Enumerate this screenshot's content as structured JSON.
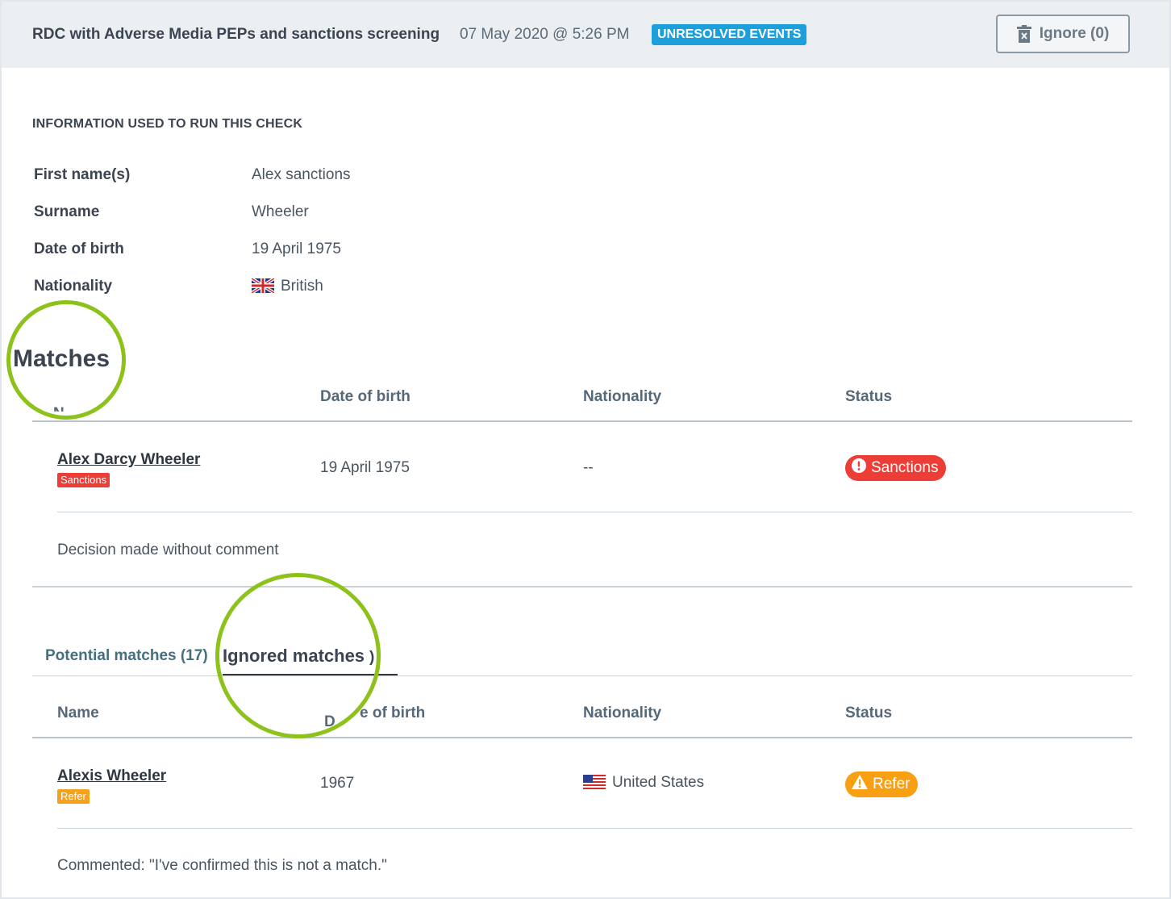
{
  "header": {
    "title": "RDC with Adverse Media PEPs and sanctions screening",
    "datetime": "07 May 2020 @ 5:26 PM",
    "badge": "UNRESOLVED EVENTS",
    "ignore_button": "Ignore (0)",
    "icon": "trash-icon"
  },
  "info": {
    "title": "INFORMATION USED TO RUN THIS CHECK",
    "fields": [
      {
        "label": "First name(s)",
        "value": "Alex sanctions"
      },
      {
        "label": "Surname",
        "value": "Wheeler"
      },
      {
        "label": "Date of birth",
        "value": "19 April 1975"
      },
      {
        "label": "Nationality",
        "value": "British",
        "icon": "uk-flag-icon"
      }
    ]
  },
  "matches": {
    "title": "Matches",
    "name_header_fragment": "N",
    "columns": [
      "Date of birth",
      "Nationality",
      "Status"
    ],
    "rows": [
      {
        "name": "Alex Darcy Wheeler",
        "tag": "Sanctions",
        "dob": "19 April 1975",
        "nationality": "--",
        "status": "Sanctions",
        "status_icon": "alert-circle-icon",
        "comment": "Decision made without comment"
      }
    ],
    "colors": {
      "danger": "#ec3d37",
      "warning": "#f9a012",
      "highlight": "#8cc21a"
    }
  },
  "potential": {
    "tabs": [
      {
        "label": "Potential matches (17)",
        "active": false
      },
      {
        "label": "Ignored matches",
        "suffix": ")",
        "active": true
      }
    ],
    "columns": [
      "Name",
      "D",
      "e of birth",
      "Nationality",
      "Status"
    ],
    "rows": [
      {
        "name": "Alexis Wheeler",
        "tag": "Refer",
        "dob": "1967",
        "nationality": "United States",
        "nationality_icon": "us-flag-icon",
        "status": "Refer",
        "status_icon": "warning-triangle-icon",
        "comment": "Commented: \"I've confirmed this is not a match.\""
      }
    ]
  }
}
